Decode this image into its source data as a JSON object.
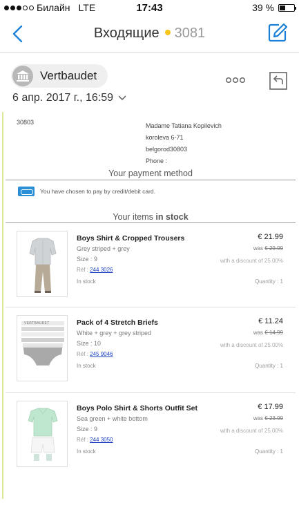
{
  "status_bar": {
    "carrier": "Билайн",
    "network": "LTE",
    "time": "17:43",
    "battery": "39 %",
    "battery_level": 0.39
  },
  "nav": {
    "title": "Входящие",
    "unread_count": "3081",
    "dot_color": "#f5c518",
    "accent": "#1a7fd6"
  },
  "message": {
    "sender": "Vertbaudet",
    "date": "6 апр. 2017 г., 16:59"
  },
  "email": {
    "address_left": "30803",
    "address_lines": [
      "Madame Tatiana Kopilevich",
      "koroleva 6-71",
      "belgorod30803",
      "Phone :"
    ],
    "payment_heading": "Your payment method",
    "payment_text": "You have chosen to pay by credit/debit card.",
    "items_heading": "Your items",
    "items_heading_bold": "in stock",
    "items": [
      {
        "name": "Boys Shirt & Cropped Trousers",
        "color": "Grey striped + grey",
        "size": "Size : 9",
        "ref_label": "Réf :",
        "ref": "244 3026",
        "stock": "In stock",
        "price": "€ 21.99",
        "was_label": "was",
        "was": "€ 29.99",
        "discount": "with a discount of 25.00%",
        "quantity": "Quantity : 1"
      },
      {
        "name": "Pack of 4 Stretch Briefs",
        "color": "White + grey + grey striped",
        "size": "Size : 10",
        "ref_label": "Réf :",
        "ref": "245 9046",
        "stock": "In stock",
        "price": "€ 11.24",
        "was_label": "was",
        "was": "€ 14.99",
        "discount": "with a discount of 25.00%",
        "quantity": "Quantity : 1",
        "brand_mark": "VERTBAUDET"
      },
      {
        "name": "Boys Polo Shirt & Shorts Outfit Set",
        "color": "Sea green + white bottom",
        "size": "Size : 9",
        "ref_label": "Réf :",
        "ref": "244 3050",
        "stock": "In stock",
        "price": "€ 17.99",
        "was_label": "was",
        "was": "€ 23.99",
        "discount": "with a discount of 25.00%",
        "quantity": "Quantity : 1"
      }
    ]
  }
}
